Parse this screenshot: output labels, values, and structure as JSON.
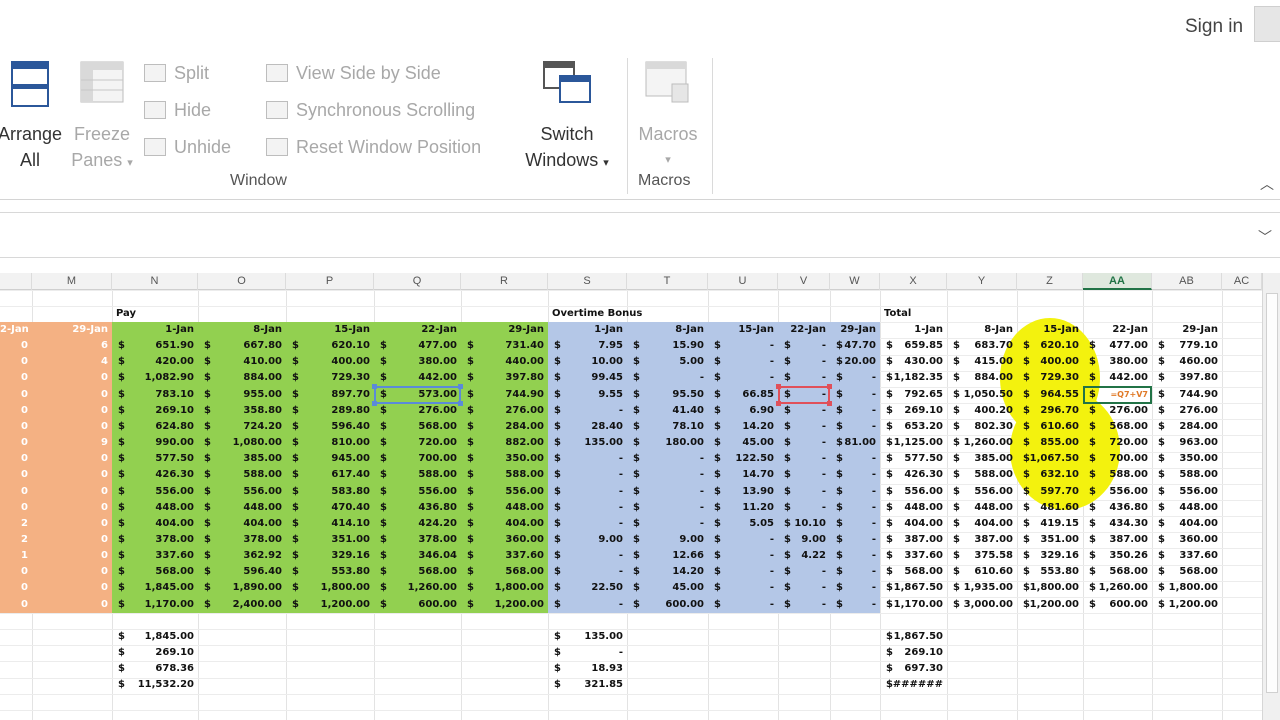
{
  "header": {
    "signin": "Sign in"
  },
  "ribbon": {
    "window_group": {
      "label": "Window",
      "arrange_all": [
        "Arrange",
        "All"
      ],
      "freeze_panes": [
        "Freeze",
        "Panes"
      ],
      "split": "Split",
      "hide": "Hide",
      "unhide": "Unhide",
      "view_side": "View Side by Side",
      "sync_scroll": "Synchronous Scrolling",
      "reset_pos": "Reset Window Position",
      "switch_windows": [
        "Switch",
        "Windows"
      ]
    },
    "macros_group": {
      "label": "Macros",
      "macros": "Macros"
    }
  },
  "columns": [
    "M",
    "N",
    "O",
    "P",
    "Q",
    "R",
    "S",
    "T",
    "U",
    "V",
    "W",
    "X",
    "Y",
    "Z",
    "AA",
    "AB",
    "AC"
  ],
  "active_column": "AA",
  "headers": {
    "pay": "Pay",
    "overtime": "Overtime Bonus",
    "total": "Total"
  },
  "dates": [
    "1-Jan",
    "8-Jan",
    "15-Jan",
    "22-Jan",
    "29-Jan"
  ],
  "left_dates": [
    "2-Jan",
    "29-Jan"
  ],
  "left_cols": [
    [
      "0",
      "6"
    ],
    [
      "0",
      "4"
    ],
    [
      "0",
      "0"
    ],
    [
      "0",
      "0"
    ],
    [
      "0",
      "0"
    ],
    [
      "0",
      "0"
    ],
    [
      "0",
      "9"
    ],
    [
      "0",
      "0"
    ],
    [
      "0",
      "0"
    ],
    [
      "0",
      "0"
    ],
    [
      "0",
      "0"
    ],
    [
      "2",
      "0"
    ],
    [
      "2",
      "0"
    ],
    [
      "1",
      "0"
    ],
    [
      "0",
      "0"
    ],
    [
      "0",
      "0"
    ],
    [
      "0",
      "0"
    ]
  ],
  "pay_rows": [
    [
      "651.90",
      "667.80",
      "620.10",
      "477.00",
      "731.40"
    ],
    [
      "420.00",
      "410.00",
      "400.00",
      "380.00",
      "440.00"
    ],
    [
      "1,082.90",
      "884.00",
      "729.30",
      "442.00",
      "397.80"
    ],
    [
      "783.10",
      "955.00",
      "897.70",
      "573.00",
      "744.90"
    ],
    [
      "269.10",
      "358.80",
      "289.80",
      "276.00",
      "276.00"
    ],
    [
      "624.80",
      "724.20",
      "596.40",
      "568.00",
      "284.00"
    ],
    [
      "990.00",
      "1,080.00",
      "810.00",
      "720.00",
      "882.00"
    ],
    [
      "577.50",
      "385.00",
      "945.00",
      "700.00",
      "350.00"
    ],
    [
      "426.30",
      "588.00",
      "617.40",
      "588.00",
      "588.00"
    ],
    [
      "556.00",
      "556.00",
      "583.80",
      "556.00",
      "556.00"
    ],
    [
      "448.00",
      "448.00",
      "470.40",
      "436.80",
      "448.00"
    ],
    [
      "404.00",
      "404.00",
      "414.10",
      "424.20",
      "404.00"
    ],
    [
      "378.00",
      "378.00",
      "351.00",
      "378.00",
      "360.00"
    ],
    [
      "337.60",
      "362.92",
      "329.16",
      "346.04",
      "337.60"
    ],
    [
      "568.00",
      "596.40",
      "553.80",
      "568.00",
      "568.00"
    ],
    [
      "1,845.00",
      "1,890.00",
      "1,800.00",
      "1,260.00",
      "1,800.00"
    ],
    [
      "1,170.00",
      "2,400.00",
      "1,200.00",
      "600.00",
      "1,200.00"
    ]
  ],
  "ot_rows": [
    [
      "7.95",
      "15.90",
      "-",
      "-",
      "47.70"
    ],
    [
      "10.00",
      "5.00",
      "-",
      "-",
      "20.00"
    ],
    [
      "99.45",
      "-",
      "-",
      "-",
      "-"
    ],
    [
      "9.55",
      "95.50",
      "66.85",
      "-",
      "-"
    ],
    [
      "-",
      "41.40",
      "6.90",
      "-",
      "-"
    ],
    [
      "28.40",
      "78.10",
      "14.20",
      "-",
      "-"
    ],
    [
      "135.00",
      "180.00",
      "45.00",
      "-",
      "81.00"
    ],
    [
      "-",
      "-",
      "122.50",
      "-",
      "-"
    ],
    [
      "-",
      "-",
      "14.70",
      "-",
      "-"
    ],
    [
      "-",
      "-",
      "13.90",
      "-",
      "-"
    ],
    [
      "-",
      "-",
      "11.20",
      "-",
      "-"
    ],
    [
      "-",
      "-",
      "5.05",
      "10.10",
      "-"
    ],
    [
      "9.00",
      "9.00",
      "-",
      "9.00",
      "-"
    ],
    [
      "-",
      "12.66",
      "-",
      "4.22",
      "-"
    ],
    [
      "-",
      "14.20",
      "-",
      "-",
      "-"
    ],
    [
      "22.50",
      "45.00",
      "-",
      "-",
      "-"
    ],
    [
      "-",
      "600.00",
      "-",
      "-",
      "-"
    ]
  ],
  "total_rows": [
    [
      "659.85",
      "683.70",
      "620.10",
      "477.00",
      "779.10"
    ],
    [
      "430.00",
      "415.00",
      "400.00",
      "380.00",
      "460.00"
    ],
    [
      "1,182.35",
      "884.00",
      "729.30",
      "442.00",
      "397.80"
    ],
    [
      "792.65",
      "1,050.50",
      "964.55",
      "=Q7+V7",
      "744.90"
    ],
    [
      "269.10",
      "400.20",
      "296.70",
      "276.00",
      "276.00"
    ],
    [
      "653.20",
      "802.30",
      "610.60",
      "568.00",
      "284.00"
    ],
    [
      "1,125.00",
      "1,260.00",
      "855.00",
      "720.00",
      "963.00"
    ],
    [
      "577.50",
      "385.00",
      "1,067.50",
      "700.00",
      "350.00"
    ],
    [
      "426.30",
      "588.00",
      "632.10",
      "588.00",
      "588.00"
    ],
    [
      "556.00",
      "556.00",
      "597.70",
      "556.00",
      "556.00"
    ],
    [
      "448.00",
      "448.00",
      "481.60",
      "436.80",
      "448.00"
    ],
    [
      "404.00",
      "404.00",
      "419.15",
      "434.30",
      "404.00"
    ],
    [
      "387.00",
      "387.00",
      "351.00",
      "387.00",
      "360.00"
    ],
    [
      "337.60",
      "375.58",
      "329.16",
      "350.26",
      "337.60"
    ],
    [
      "568.00",
      "610.60",
      "553.80",
      "568.00",
      "568.00"
    ],
    [
      "1,867.50",
      "1,935.00",
      "1,800.00",
      "1,260.00",
      "1,800.00"
    ],
    [
      "1,170.00",
      "3,000.00",
      "1,200.00",
      "600.00",
      "1,200.00"
    ]
  ],
  "summary": {
    "pay": [
      "1,845.00",
      "269.10",
      "678.36",
      "11,532.20"
    ],
    "ot": [
      "135.00",
      "-",
      "18.93",
      "321.85"
    ],
    "total": [
      "1,867.50",
      "269.10",
      "697.30",
      "######"
    ]
  },
  "dollar": "$",
  "colors": {
    "pay_band": "#92d050",
    "ot_band": "#b4c7e7",
    "left_band": "#f4b183",
    "highlight": "#f3f20e",
    "excel_green": "#217346"
  }
}
